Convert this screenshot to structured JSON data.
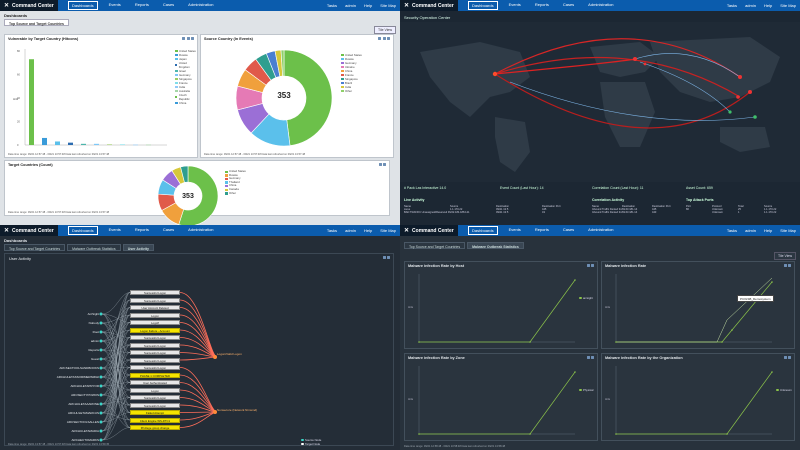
{
  "nav": {
    "brand": "Command Center",
    "menu": [
      "Dashboards",
      "Events",
      "Reports",
      "Cases",
      "Administration"
    ],
    "right": [
      "Tasks",
      "admin",
      "Help",
      "Site Map"
    ]
  },
  "q1": {
    "subhead": "Dashboards",
    "tab": "Top Source and Target Countries",
    "button": "Tile View",
    "vuln_title": "Vulnerable by Target Country (Hitcons)",
    "vuln_values": [
      73,
      6,
      3,
      2,
      1,
      1,
      0.5,
      0.5,
      0.3,
      0.3
    ],
    "vuln_ylabel": "Hits",
    "vuln_legend": [
      "United States",
      "Russia",
      "Japan",
      "United Kingdom",
      "Israel",
      "Germany",
      "Singapore",
      "France",
      "India",
      "Australia",
      "Czech Republic",
      "China"
    ],
    "source_title": "Source Country (In Events)",
    "donut_total": "353",
    "source_legend": [
      "United States",
      "Russia",
      "Germany",
      "Ukraine",
      "China",
      "France",
      "Singapore",
      "Brazil",
      "India",
      "Other"
    ],
    "target_title": "Target Countries (Count)",
    "target_total": "353",
    "target_legend": [
      "United States",
      "Russia",
      "Germany",
      "Thailand",
      "China",
      "Canada",
      "Other"
    ],
    "foot1": "Data time range: 09/21 12:57:48 - 09/21 13:57:48 Data last refreshed on 09/21 13:57:48",
    "foot2": "Data time range: 09/21 12:57:48 - 09/21 13:57:48 Data last refreshed on 09/21 13:57:48",
    "foot3": "Data time range: 09/21 12:57:48 - 09/21 13:57:48 Data last refreshed on 09/21 13:57:48"
  },
  "q2": {
    "title": "Security Operation Center",
    "stats": [
      "# Pack Las Interactive 14.0",
      "Event Count (Last Hour): 14",
      "Correlation Count (Last Hour): 11",
      "Asset Count: 659"
    ],
    "live": "Live Activity",
    "correlation": "Correlation Activity",
    "top_attack": "Top Attack Ports",
    "activity_rows": [
      [
        "Name",
        "Source",
        "Destination",
        "Destination Port"
      ],
      [
        "Lieve",
        "1.1.170.22",
        "09/21 13:5",
        "445"
      ],
      [
        "BAD TRAFFIC Unassigned/Reserved Protocol",
        "222.184.188.121",
        "09/21 13:5",
        "43"
      ]
    ],
    "corr_rows": [
      [
        "Name",
        "Destination",
        "Destination Port"
      ],
      [
        "Inbound Traffic Denied from a Suspicious",
        "69.63.181.14",
        "445"
      ],
      [
        "Inbound Traffic Denied from a Suspicious",
        "69.63.181.14",
        "443"
      ]
    ],
    "port_rows": [
      [
        "Port",
        "Protocol",
        "Total",
        "Source"
      ],
      [
        "80",
        "Unknown",
        "25",
        "1.1.170.22"
      ],
      [
        "",
        "Unknown",
        "1",
        "1.1.170.22"
      ]
    ]
  },
  "q3": {
    "subhead": "Dashboards",
    "tabs": [
      "Top Source and Target Countries",
      "Malware Outbreak Statistics",
      "User Activity"
    ],
    "panel_title": "User Activity",
    "users": [
      "ArcSight",
      "Nobody",
      "Root",
      "admin",
      "Reports",
      "Guest",
      "ARCSECTOOLSANDBOOKS",
      "ARCHULETASSORIMERSMIHI",
      "ARCHULETAPRYOR",
      "ARCSECTYPOWOS",
      "ARCHULETAAARONE",
      "ARCHULETAMARCUS",
      "ARCSECTOOLSALLEN",
      "ARCHULETAMADIA",
      "ARCHECTOMARKS"
    ],
    "events": [
      {
        "t": "Successful Logon",
        "y": false
      },
      {
        "t": "Successful Logon",
        "y": false
      },
      {
        "t": "User Account Deleted",
        "y": false
      },
      {
        "t": "Logon",
        "y": false
      },
      {
        "t": "Logoff",
        "y": false
      },
      {
        "t": "Logon Failure - Account",
        "y": true
      },
      {
        "t": "Successful Logon",
        "y": false
      },
      {
        "t": "Successful Logon",
        "y": false
      },
      {
        "t": "Successful Logon",
        "y": false
      },
      {
        "t": "Successful Logon",
        "y": false
      },
      {
        "t": "Successful Logon",
        "y": false
      },
      {
        "t": "PHASE 1 COMPLETED",
        "y": true
      },
      {
        "t": "User Authenticated",
        "y": false
      },
      {
        "t": "Logon",
        "y": false
      },
      {
        "t": "Successful Logon",
        "y": false
      },
      {
        "t": "Successful Logon",
        "y": false
      },
      {
        "t": "Failed Attempt",
        "y": true
      },
      {
        "t": "Client Engine WS-DTC1",
        "y": true
      },
      {
        "t": "Privilege group change",
        "y": true
      }
    ],
    "targets": [
      "Logon/Valid Logon",
      "Nonsecure (Network Nimsmd)"
    ],
    "legend": [
      "Source Node",
      "Target Node",
      "Event Node"
    ],
    "foot": "Data time range: 09/21 13:57:48 - 09/21 13:57:48 Data last refreshed on 09/21 13:59:35"
  },
  "q4": {
    "tabs": [
      "Top Source and Target Countries",
      "Malware Outbreak Statistics"
    ],
    "button": "Tile View",
    "charts": [
      {
        "title": "Malware infection Rate by Host",
        "legend": "arcsight",
        "tag": ""
      },
      {
        "title": "Malware infection Rate",
        "legend": "",
        "tag": "PCIGSB_Demosystem"
      },
      {
        "title": "Malware infection Rate by Zone",
        "legend": "Physical",
        "tag": ""
      },
      {
        "title": "Malware infection Rate by the Organization",
        "legend": "Unknown",
        "tag": ""
      }
    ],
    "chart_ylabel": "Hits",
    "foot": "Data time range: 09/21 12:58:48 - 09/21 13:58:48 Data last refreshed on 09/21 13:58:48"
  }
}
